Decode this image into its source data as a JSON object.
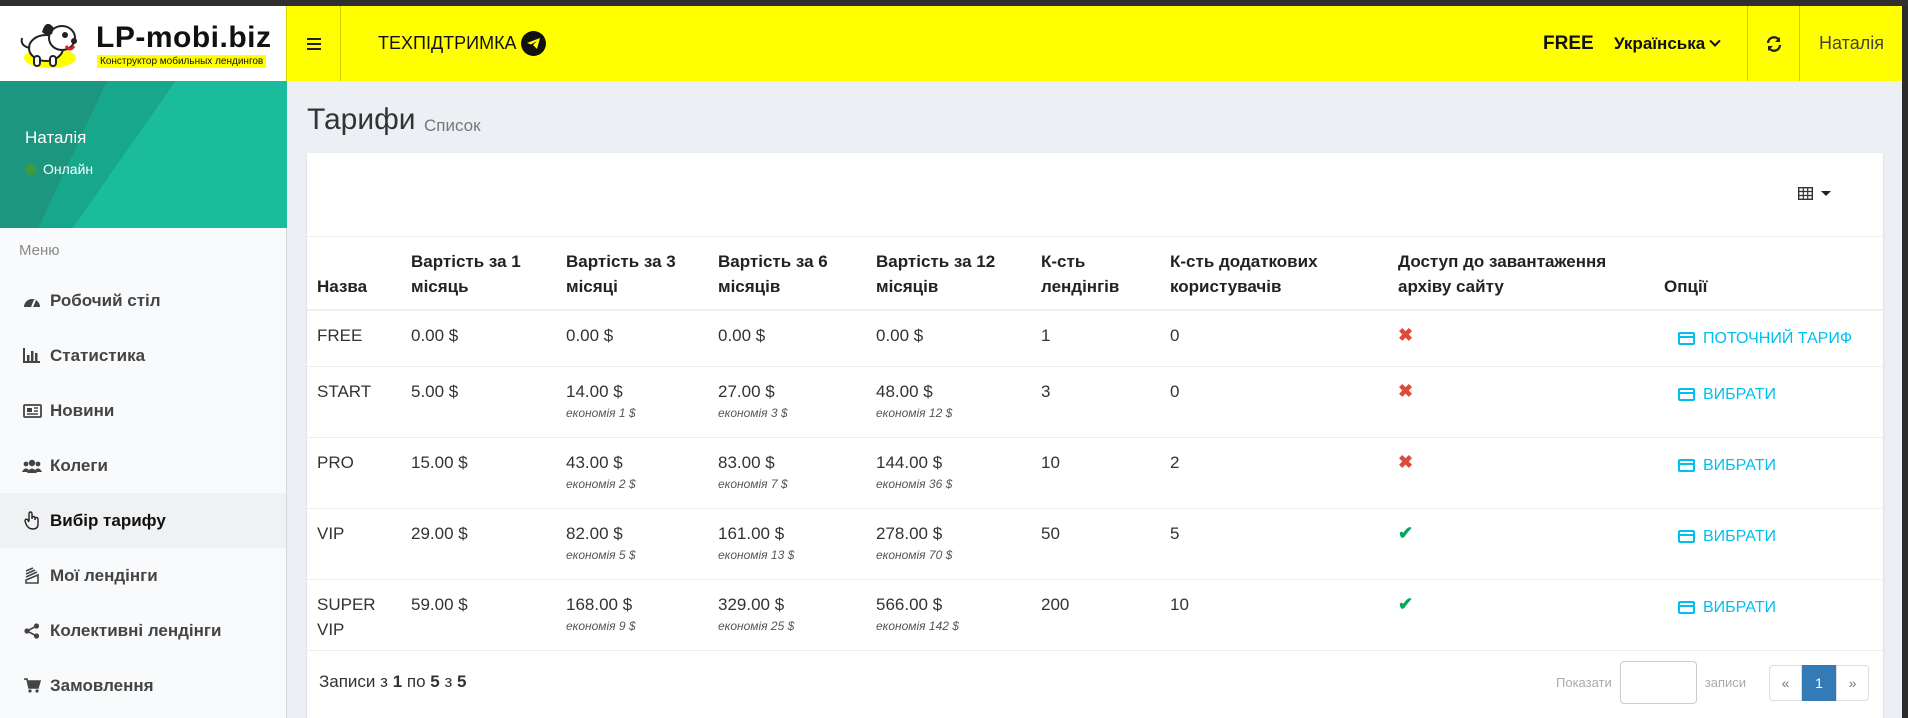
{
  "brand": {
    "title": "LP-mobi.biz",
    "subtitle": "Конструктор мобильных лендингов"
  },
  "header": {
    "support_label": "ТЕХПІДТРИМКА",
    "plan_badge": "FREE",
    "language": "Українська",
    "user_name": "Наталія"
  },
  "sidebar": {
    "user": {
      "name": "Наталія",
      "status": "Онлайн"
    },
    "menu_header": "Меню",
    "items": [
      {
        "label": "Робочий стіл",
        "icon": "dashboard-icon"
      },
      {
        "label": "Статистика",
        "icon": "bar-chart-icon"
      },
      {
        "label": "Новини",
        "icon": "newspaper-icon"
      },
      {
        "label": "Колеги",
        "icon": "users-icon"
      },
      {
        "label": "Вибір тарифу",
        "icon": "hand-pointer-icon",
        "active": true
      },
      {
        "label": "Мої лендінги",
        "icon": "layers-icon"
      },
      {
        "label": "Колективні лендінги",
        "icon": "share-icon"
      },
      {
        "label": "Замовлення",
        "icon": "cart-icon"
      }
    ]
  },
  "page": {
    "title": "Тарифи",
    "subtitle": "Список"
  },
  "table": {
    "headers": [
      "Назва",
      "Вартість за 1 місяць",
      "Вартість за 3 місяці",
      "Вартість за 6 місяців",
      "Вартість за 12 місяців",
      "К-сть лендінгів",
      "К-сть додаткових користувачів",
      "Доступ до завантаження архіву сайту",
      "Опції"
    ],
    "rows": [
      {
        "name": "FREE",
        "p1": "0.00 $",
        "p3": "0.00 $",
        "p3s": "",
        "p6": "0.00 $",
        "p6s": "",
        "p12": "0.00 $",
        "p12s": "",
        "landings": "1",
        "users": "0",
        "archive": "✖",
        "option": "ПОТОЧНИЙ ТАРИФ"
      },
      {
        "name": "START",
        "p1": "5.00 $",
        "p3": "14.00 $",
        "p3s": "економія 1 $",
        "p6": "27.00 $",
        "p6s": "економія 3 $",
        "p12": "48.00 $",
        "p12s": "економія 12 $",
        "landings": "3",
        "users": "0",
        "archive": "✖",
        "option": "ВИБРАТИ"
      },
      {
        "name": "PRO",
        "p1": "15.00 $",
        "p3": "43.00 $",
        "p3s": "економія 2 $",
        "p6": "83.00 $",
        "p6s": "економія 7 $",
        "p12": "144.00 $",
        "p12s": "економія 36 $",
        "landings": "10",
        "users": "2",
        "archive": "✖",
        "option": "ВИБРАТИ"
      },
      {
        "name": "VIP",
        "p1": "29.00 $",
        "p3": "82.00 $",
        "p3s": "економія 5 $",
        "p6": "161.00 $",
        "p6s": "економія 13 $",
        "p12": "278.00 $",
        "p12s": "економія 70 $",
        "landings": "50",
        "users": "5",
        "archive": "✔",
        "option": "ВИБРАТИ"
      },
      {
        "name": "SUPER VIP",
        "p1": "59.00 $",
        "p3": "168.00 $",
        "p3s": "економія 9 $",
        "p6": "329.00 $",
        "p6s": "економія 25 $",
        "p12": "566.00 $",
        "p12s": "економія 142 $",
        "landings": "200",
        "users": "10",
        "archive": "✔",
        "option": "ВИБРАТИ"
      }
    ]
  },
  "footer": {
    "records_prefix": "Записи з",
    "from": "1",
    "to_word": "по",
    "to": "5",
    "of_word": "з",
    "total": "5",
    "show_label": "Показати",
    "records_label": "записи",
    "pager": {
      "prev": "«",
      "current": "1",
      "next": "»"
    }
  },
  "colors": {
    "header_bg": "#ffff00",
    "accent": "#1abc9c",
    "link": "#00c0ef",
    "no": "#dd4b39",
    "yes": "#00a65a"
  }
}
